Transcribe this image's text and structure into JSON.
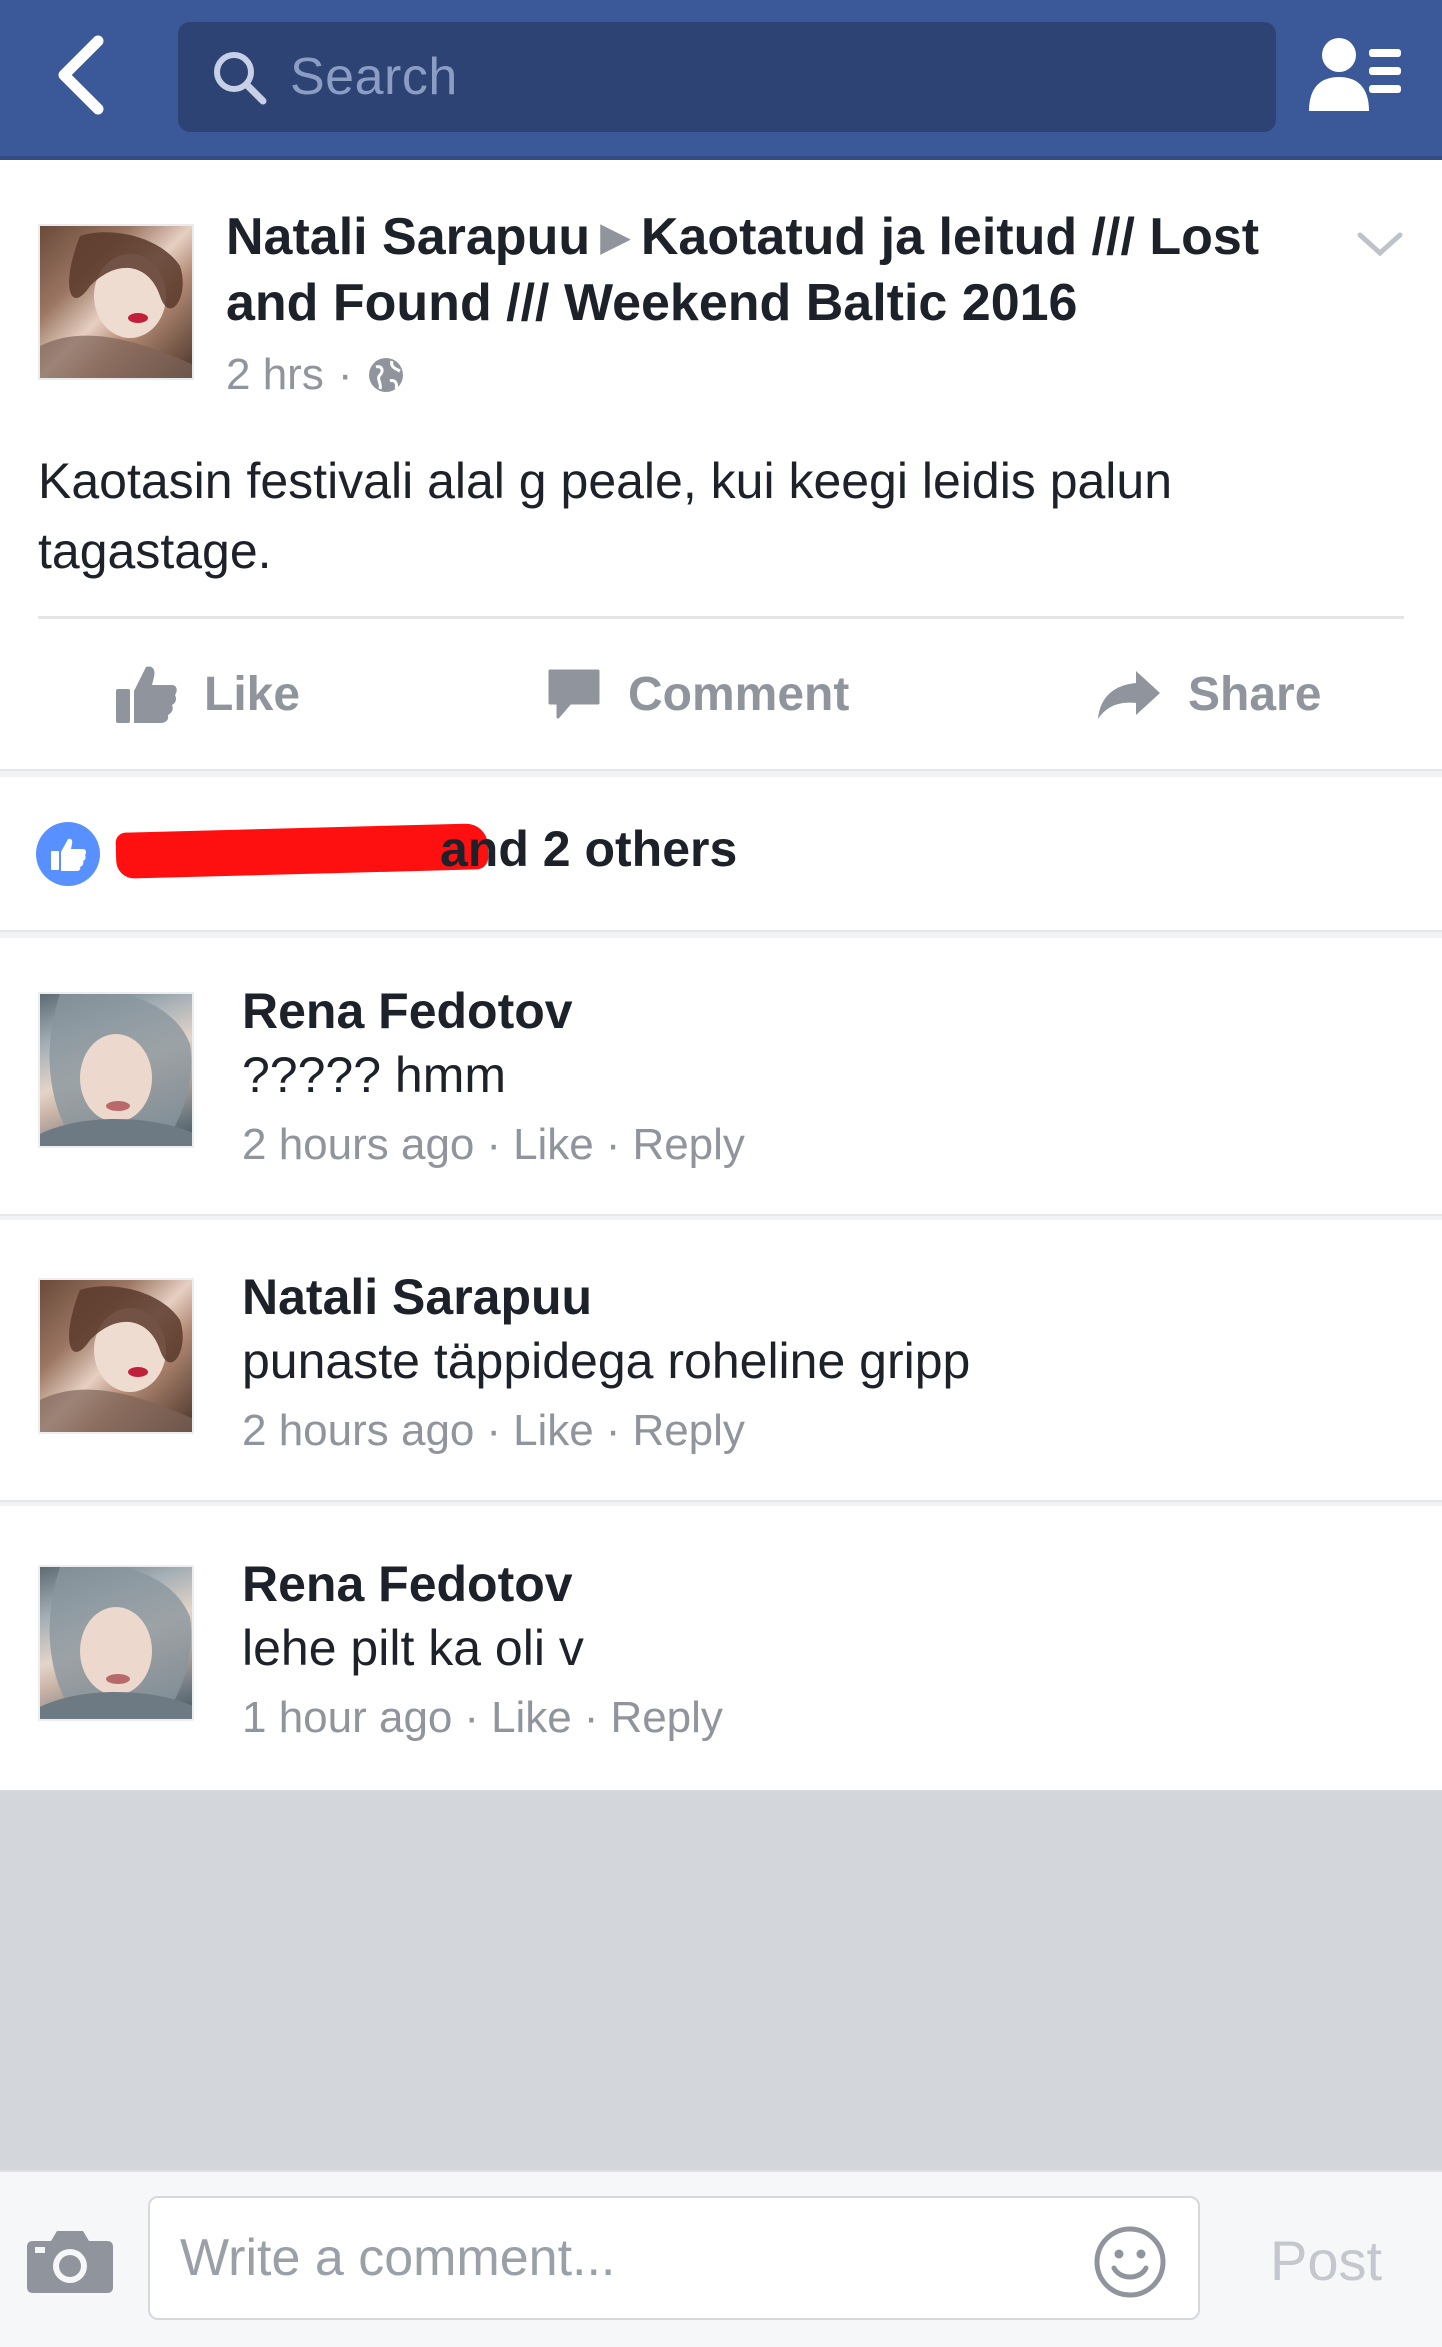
{
  "nav": {
    "search_placeholder": "Search"
  },
  "post": {
    "author": "Natali Sarapuu",
    "group": "Kaotatud ja leitud /// Lost and Found /// Weekend Baltic 2016",
    "time": "2 hrs",
    "privacy_icon": "globe-icon",
    "body": "Kaotasin festivali alal g peale, kui keegi leidis palun tagastage."
  },
  "actions": {
    "like": "Like",
    "comment": "Comment",
    "share": "Share"
  },
  "reactions": {
    "text": "and 2 others"
  },
  "comments": [
    {
      "name": "Rena Fedotov",
      "text": "????? hmm",
      "time": "2 hours ago",
      "like": "Like",
      "reply": "Reply"
    },
    {
      "name": "Natali Sarapuu",
      "text": "punaste täppidega roheline gripp",
      "time": "2 hours ago",
      "like": "Like",
      "reply": "Reply"
    },
    {
      "name": "Rena Fedotov",
      "text": "lehe pilt ka oli v",
      "time": "1 hour ago",
      "like": "Like",
      "reply": "Reply"
    }
  ],
  "composer": {
    "placeholder": "Write a comment...",
    "post_label": "Post"
  },
  "colors": {
    "navbar": "#3b5998",
    "like_badge": "#5890ff",
    "redaction": "#ff1010"
  }
}
